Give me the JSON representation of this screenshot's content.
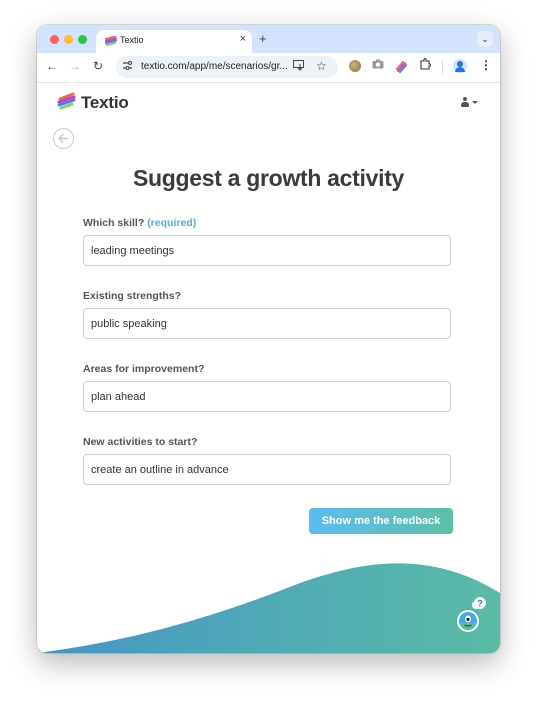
{
  "browser": {
    "tab": {
      "title": "Textio",
      "close": "×"
    },
    "new_tab": "+",
    "tab_menu": "⌄",
    "nav": {
      "back": "←",
      "forward": "→",
      "reload": "↻"
    },
    "omnibox": {
      "url": "textio.com/app/me/scenarios/gr...",
      "tune_icon": "⚙",
      "install_icon": "⇩",
      "star": "☆"
    },
    "extensions": {
      "camera": "◙",
      "puzzle": "⧉"
    },
    "menu": "⋮"
  },
  "app": {
    "logo_text": "Textio",
    "brand_colors": {
      "accent": "#47b0e8",
      "gradient_start": "#5bbcf2",
      "gradient_end": "#5bc0a8"
    }
  },
  "form": {
    "title": "Suggest a growth activity",
    "fields": [
      {
        "label": "Which skill?",
        "required_note": "(required)",
        "value": "leading meetings"
      },
      {
        "label": "Existing strengths?",
        "value": "public speaking"
      },
      {
        "label": "Areas for improvement?",
        "value": "plan ahead"
      },
      {
        "label": "New activities to start?",
        "value": "create an outline in advance"
      }
    ],
    "submit_label": "Show me the feedback"
  },
  "helper": {
    "bubble": "?"
  }
}
